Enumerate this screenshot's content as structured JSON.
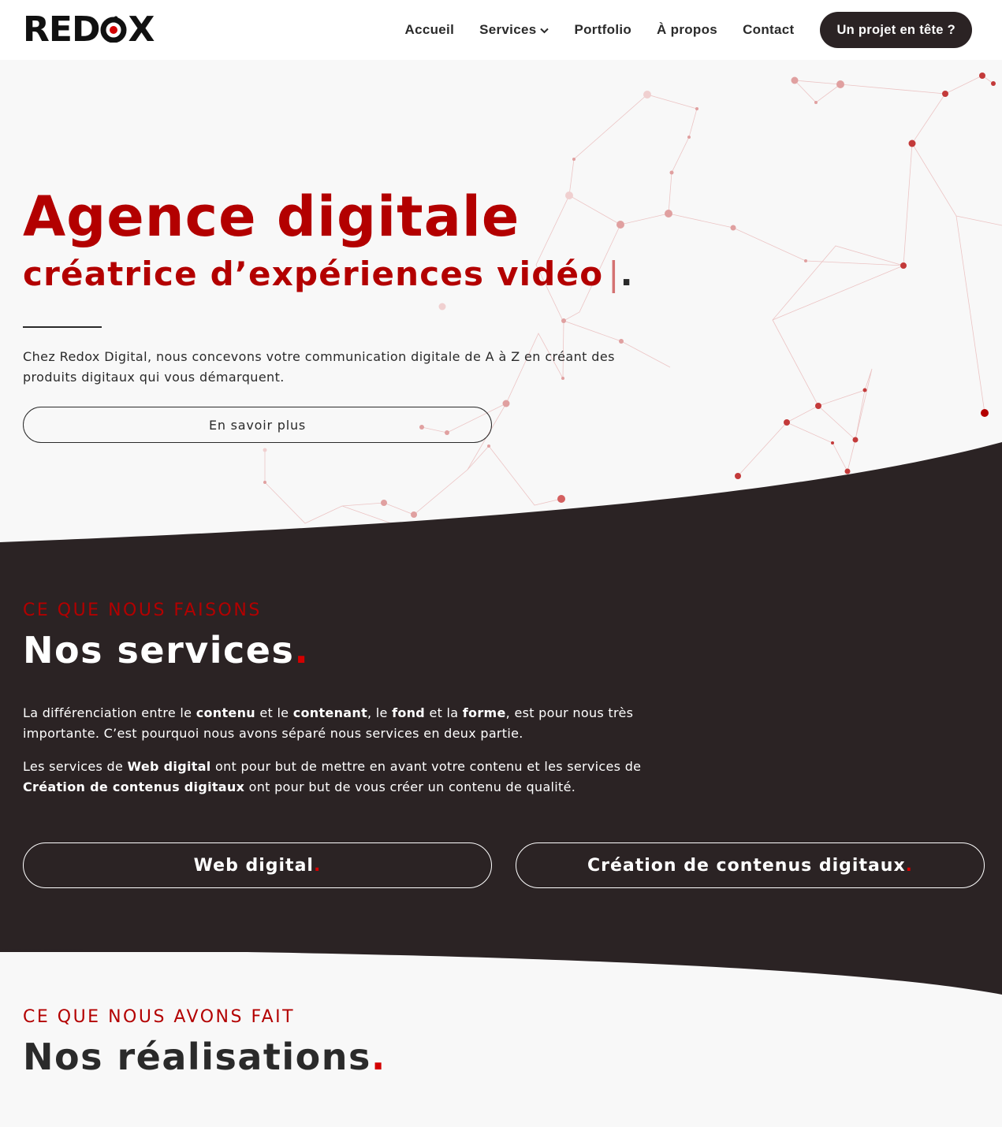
{
  "header": {
    "logo_text": "REDOX",
    "nav": [
      "Accueil",
      "Services",
      "Portfolio",
      "À propos",
      "Contact"
    ],
    "cta_label": "Un projet en tête ?"
  },
  "hero": {
    "title": "Agence digitale",
    "subtitle": "créatrice d’expériences vidéo",
    "cursor": "|",
    "dot": ".",
    "description": "Chez Redox Digital, nous concevons votre communication digitale de A à Z en créant des produits digitaux qui vous démarquent.",
    "button_label": "En savoir plus"
  },
  "services": {
    "kicker": "CE QUE NOUS FAISONS",
    "title": "Nos services",
    "dot": ".",
    "p1": {
      "t1": "La différenciation entre le ",
      "b1": "contenu",
      "t2": " et le ",
      "b2": "contenant",
      "t3": ", le ",
      "b3": "fond",
      "t4": " et la ",
      "b4": "forme",
      "t5": ", est pour nous très importante. C’est pourquoi nous avons séparé nous services en deux partie."
    },
    "p2": {
      "t1": "Les services de ",
      "b1": "Web digital",
      "t2": " ont pour but de mettre en avant votre contenu et les services de ",
      "b2": "Création de contenus digitaux",
      "t3": " ont pour but de vous créer un contenu de qualité."
    },
    "button_web": "Web digital",
    "button_creation": "Création de contenus digitaux"
  },
  "realisations": {
    "kicker": "CE QUE NOUS AVONS FAIT",
    "title": "Nos réalisations",
    "dot": "."
  },
  "colors": {
    "accent": "#b30000",
    "dark": "#2b2324",
    "light_bg": "#f8f8f8"
  }
}
